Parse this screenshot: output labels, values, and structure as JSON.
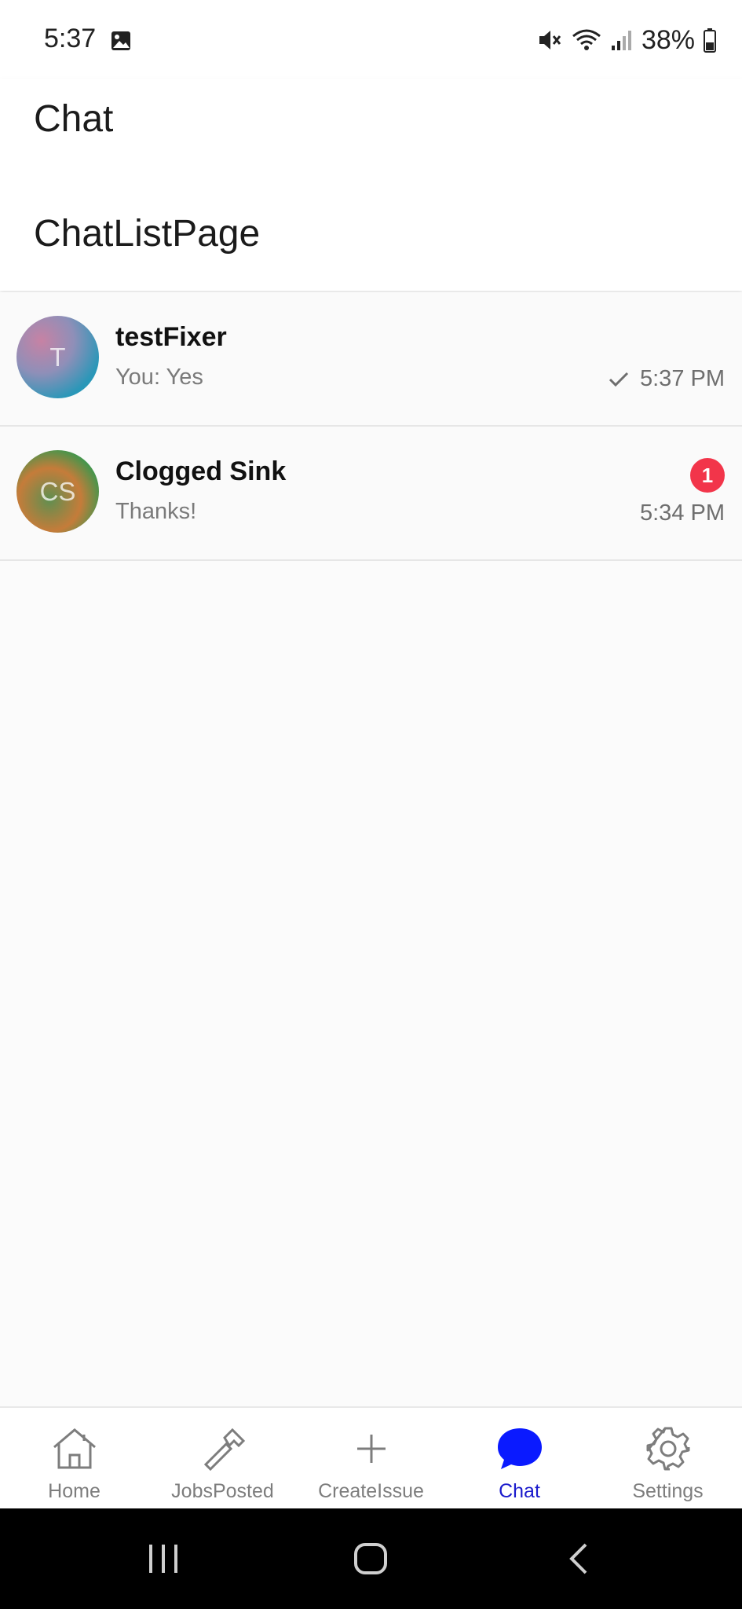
{
  "status_bar": {
    "time": "5:37",
    "battery": "38%",
    "icons": [
      "image-icon",
      "mute-icon",
      "wifi-icon",
      "signal-icon",
      "battery-icon"
    ]
  },
  "header": {
    "title": "Chat",
    "subtitle": "ChatListPage"
  },
  "chats": [
    {
      "name": "testFixer",
      "initials": "T",
      "preview": "You: Yes",
      "time": "5:37 PM",
      "read_receipt": true,
      "unread": null
    },
    {
      "name": "Clogged Sink",
      "initials": "CS",
      "preview": "Thanks!",
      "time": "5:34 PM",
      "read_receipt": false,
      "unread": "1"
    }
  ],
  "bottom_nav": {
    "items": [
      {
        "label": "Home",
        "icon": "home-icon"
      },
      {
        "label": "JobsPosted",
        "icon": "hammer-icon"
      },
      {
        "label": "CreateIssue",
        "icon": "plus-icon"
      },
      {
        "label": "Chat",
        "icon": "chat-bubble-icon"
      },
      {
        "label": "Settings",
        "icon": "gear-icon"
      }
    ],
    "active": "Chat"
  },
  "colors": {
    "accent": "#0a1aff",
    "badge": "#f2354a",
    "active_label": "#1a1acc"
  }
}
